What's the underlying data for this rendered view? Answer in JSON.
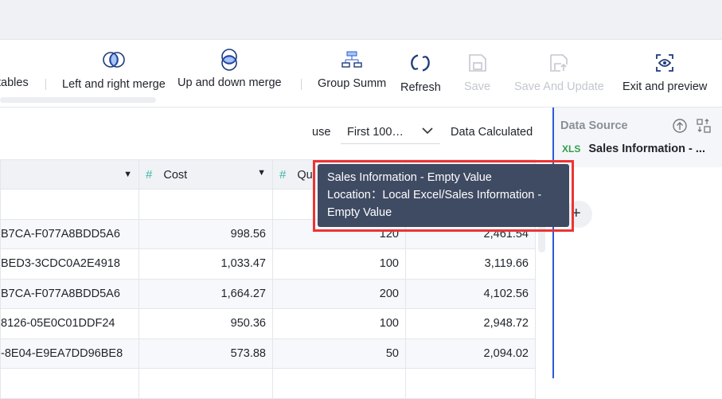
{
  "toolbar": {
    "items": [
      {
        "label": "tables"
      },
      {
        "label": "Left and right merge"
      },
      {
        "label": "Up and down merge"
      },
      {
        "label": "Group Summ"
      },
      {
        "label": "Refresh"
      },
      {
        "label": "Save",
        "disabled": true
      },
      {
        "label": "Save And Update",
        "disabled": true
      },
      {
        "label": "Exit and preview"
      }
    ]
  },
  "options": {
    "use_label": "use",
    "row_select": "First 100…",
    "calc_label": "Data Calculated"
  },
  "table": {
    "headers": [
      "",
      "Cost",
      "Qu",
      ""
    ],
    "rows": [
      [
        "",
        "",
        "",
        ""
      ],
      [
        "B7CA-F077A8BDD5A6",
        "998.56",
        "120",
        "2,461.54"
      ],
      [
        "BED3-3CDC0A2E4918",
        "1,033.47",
        "100",
        "3,119.66"
      ],
      [
        "B7CA-F077A8BDD5A6",
        "1,664.27",
        "200",
        "4,102.56"
      ],
      [
        "8126-05E0C01DDF24",
        "950.36",
        "100",
        "2,948.72"
      ],
      [
        "-8E04-E9EA7DD96BE8",
        "573.88",
        "50",
        "2,094.02"
      ]
    ]
  },
  "datasource": {
    "title": "Data Source",
    "item": "Sales Information - ...",
    "item_icon": "XLS"
  },
  "tooltip": {
    "line1": "Sales Information - Empty Value",
    "line2": "Location：Local Excel/Sales Information - Empty Value"
  },
  "add_label": "+"
}
